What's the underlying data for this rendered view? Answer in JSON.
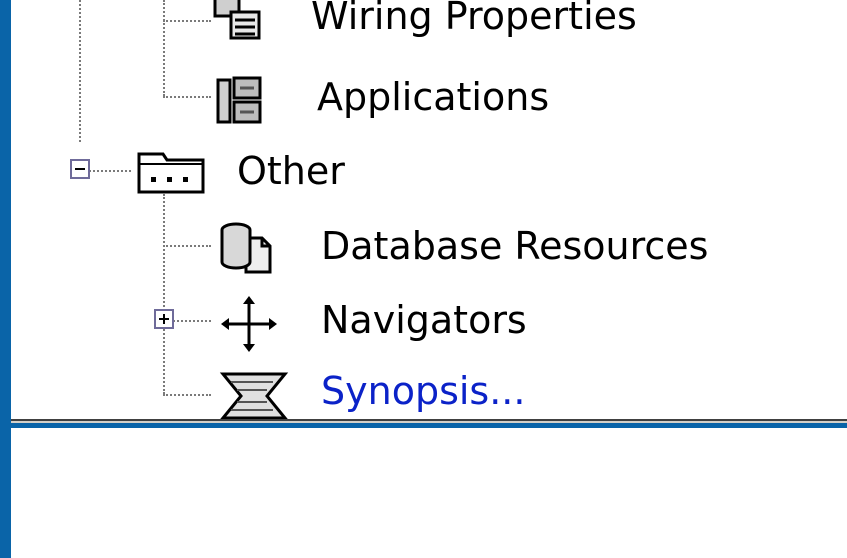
{
  "tree": {
    "items": [
      {
        "label": "Wiring Properties",
        "icon": "wiring-properties-icon"
      },
      {
        "label": "Applications",
        "icon": "applications-icon"
      },
      {
        "label": "Other",
        "icon": "folder-icon",
        "expander": "collapse"
      },
      {
        "label": "Database Resources",
        "icon": "database-icon"
      },
      {
        "label": "Navigators",
        "icon": "navigators-icon",
        "expander": "expand"
      },
      {
        "label": "Synopsis...",
        "icon": "synopsis-icon"
      }
    ]
  },
  "colors": {
    "window_frame": "#0a64a8",
    "link_text": "#0b22c8",
    "tree_lines": "#7a7a7a",
    "expander_border": "#6f6b9a"
  }
}
